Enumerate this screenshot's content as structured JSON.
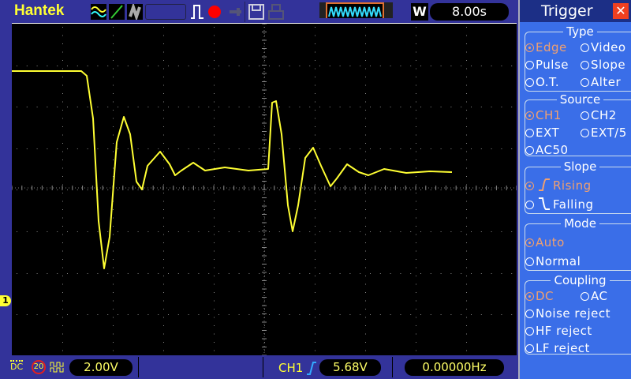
{
  "header": {
    "brand": "Hantek",
    "timebase": "8.00s",
    "window_mode": "W"
  },
  "icons": [
    "ch1-ch2-wave-icon",
    "xy-mode-icon",
    "persistence-icon",
    "pulse-trigger-icon",
    "record-icon",
    "usb-icon",
    "save-icon",
    "print-icon",
    "waveform-overview-icon"
  ],
  "footer": {
    "coupling": "DC",
    "bw_limit": "20",
    "volts_div": "2.00V",
    "trigger_source": "CH1",
    "trigger_level": "5.68V",
    "frequency": "0.00000Hz"
  },
  "channel_marker": "1",
  "trigger_panel": {
    "title": "Trigger",
    "type": {
      "label": "Type",
      "options": [
        "Edge",
        "Video",
        "Pulse",
        "Slope",
        "O.T.",
        "Alter"
      ],
      "selected": "Edge"
    },
    "source": {
      "label": "Source",
      "options": [
        "CH1",
        "CH2",
        "EXT",
        "EXT/5",
        "AC50"
      ],
      "selected": "CH1"
    },
    "slope": {
      "label": "Slope",
      "options": [
        "Rising",
        "Falling"
      ],
      "selected": "Rising"
    },
    "mode": {
      "label": "Mode",
      "options": [
        "Auto",
        "Normal"
      ],
      "selected": "Auto"
    },
    "coupling": {
      "label": "Coupling",
      "options": [
        "DC",
        "AC",
        "Noise reject",
        "HF reject",
        "LF reject"
      ],
      "selected": "DC"
    }
  },
  "colors": {
    "trace": "#ffff33",
    "panel": "#3a6ee8",
    "selected": "#f0a070",
    "background": "#33339a"
  }
}
